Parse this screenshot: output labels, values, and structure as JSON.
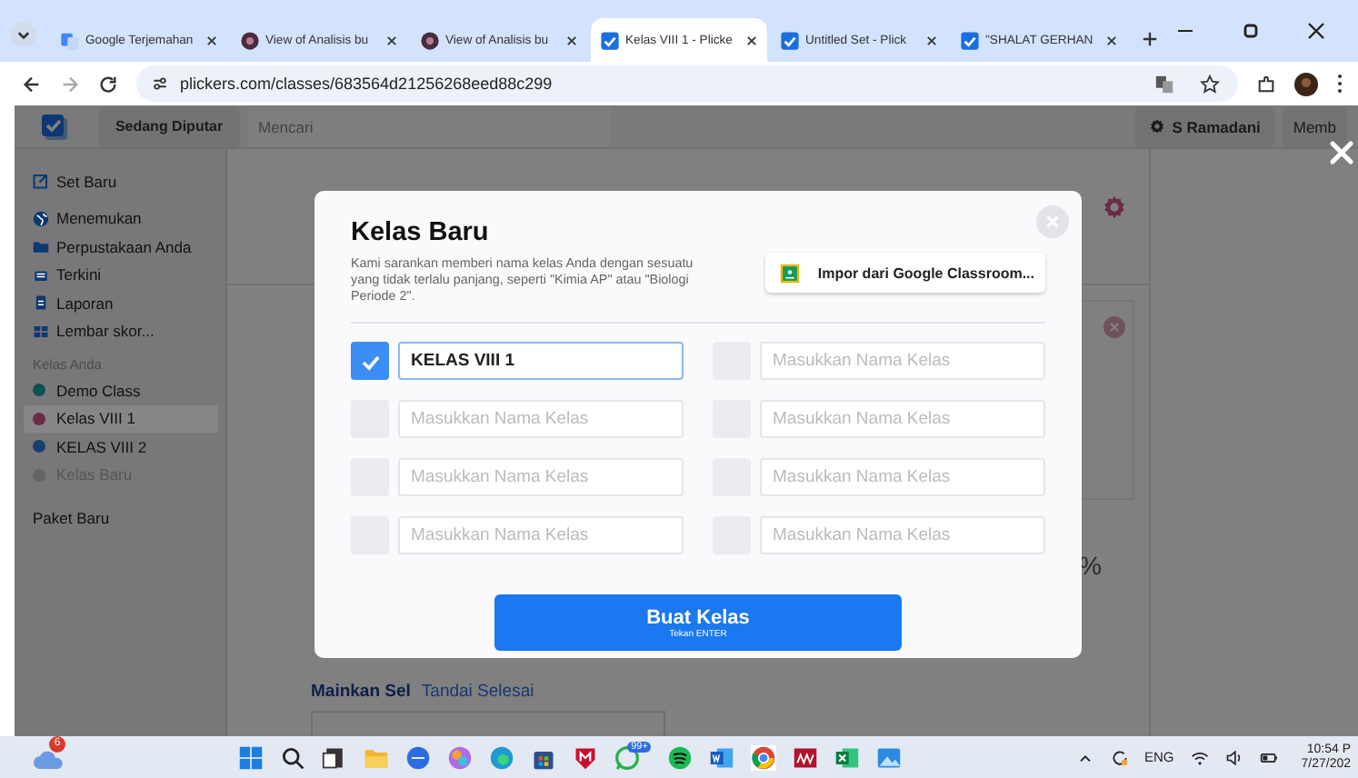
{
  "browser": {
    "tabs": [
      {
        "title": "Google Terjemahan",
        "kind": "translate",
        "selected": false
      },
      {
        "title": "View of Analisis bu",
        "kind": "journal",
        "selected": false
      },
      {
        "title": "View of Analisis bu",
        "kind": "journal",
        "selected": false
      },
      {
        "title": "Kelas VIII 1 - Plicke",
        "kind": "check",
        "selected": true
      },
      {
        "title": "Untitled Set - Plick",
        "kind": "check",
        "selected": false
      },
      {
        "title": "\"SHALAT GERHAN",
        "kind": "check",
        "selected": false
      }
    ],
    "address": "plickers.com/classes/683564d21256268eed88c299"
  },
  "app": {
    "header": {
      "now_playing": "Sedang Diputar",
      "search_placeholder": "Mencari",
      "user": "S Ramadani",
      "member": "Memb"
    },
    "sidebar": {
      "items": [
        {
          "label": "Set Baru",
          "kind": "new-set"
        },
        {
          "label": "Menemukan",
          "kind": "discover"
        },
        {
          "label": "Perpustakaan Anda",
          "kind": "library"
        },
        {
          "label": "Terkini",
          "kind": "recent"
        },
        {
          "label": "Laporan",
          "kind": "reports"
        },
        {
          "label": "Lembar skor...",
          "kind": "scoresheet"
        }
      ],
      "section": "Kelas Anda",
      "classes": [
        {
          "label": "Demo Class",
          "color": "#0d524e",
          "selected": false,
          "disabled": false
        },
        {
          "label": "Kelas VIII 1",
          "color": "#692b48",
          "selected": true,
          "disabled": false
        },
        {
          "label": "KELAS VIII 2",
          "color": "#183f71",
          "selected": false,
          "disabled": false
        },
        {
          "label": "Kelas Baru",
          "color": "#646464",
          "selected": false,
          "disabled": true
        }
      ],
      "footer": "Paket Baru"
    },
    "main": {
      "percent": "%",
      "links": [
        "Mainkan Sel",
        "Tandai Selesai"
      ]
    }
  },
  "modal": {
    "title": "Kelas Baru",
    "description": "Kami sarankan memberi nama kelas Anda dengan sesuatu yang tidak terlalu panjang, seperti \"Kimia AP\" atau \"Biologi Periode 2\".",
    "import_button": "Impor dari Google Classroom...",
    "fields": [
      {
        "checked": true,
        "value": "KELAS VIII 1"
      },
      {
        "checked": false,
        "placeholder": "Masukkan Nama Kelas"
      },
      {
        "checked": false,
        "placeholder": "Masukkan Nama Kelas"
      },
      {
        "checked": false,
        "placeholder": "Masukkan Nama Kelas"
      },
      {
        "checked": false,
        "placeholder": "Masukkan Nama Kelas"
      },
      {
        "checked": false,
        "placeholder": "Masukkan Nama Kelas"
      },
      {
        "checked": false,
        "placeholder": "Masukkan Nama Kelas"
      },
      {
        "checked": false,
        "placeholder": "Masukkan Nama Kelas"
      }
    ],
    "submit": {
      "label": "Buat Kelas",
      "hint": "Tekan ENTER"
    }
  },
  "taskbar": {
    "weather_badge": "6",
    "chat_badge": "99+",
    "language": "ENG",
    "time": "10:54 P",
    "date": "7/27/202"
  }
}
